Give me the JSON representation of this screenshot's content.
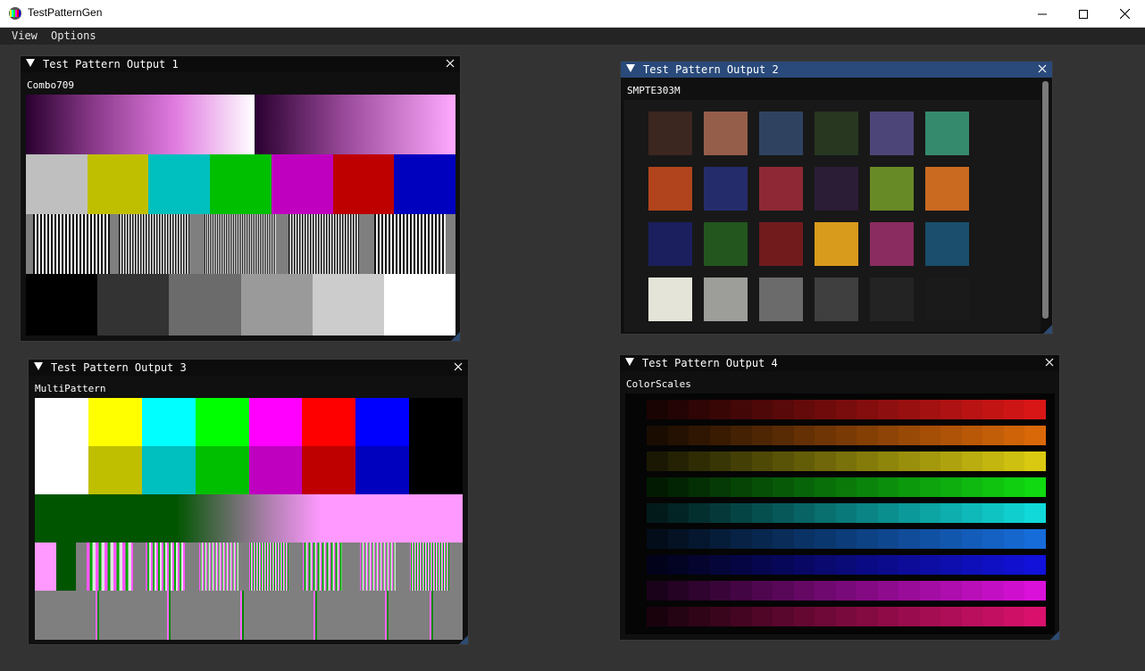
{
  "app": {
    "title": "TestPatternGen",
    "icon": "color-bars-app-icon",
    "window_controls": [
      "minimize-icon",
      "maximize-icon",
      "close-icon"
    ]
  },
  "menu": {
    "items": [
      {
        "label": "View"
      },
      {
        "label": "Options"
      }
    ]
  },
  "windows": [
    {
      "title": "Test Pattern Output 1",
      "pattern": "Combo709",
      "active": false
    },
    {
      "title": "Test Pattern Output 2",
      "pattern": "SMPTE303M",
      "active": true
    },
    {
      "title": "Test Pattern Output 3",
      "pattern": "MultiPattern",
      "active": false
    },
    {
      "title": "Test Pattern Output 4",
      "pattern": "ColorScales",
      "active": false
    }
  ],
  "colors": {
    "titlebar_active": "#294a7a",
    "window_bg": "#101010",
    "desktop_bg": "#333333",
    "bars75": [
      "#bfbfbf",
      "#bfbf00",
      "#00bfbf",
      "#00bf00",
      "#bf00bf",
      "#bf0000",
      "#0000bf"
    ],
    "bars100_top": [
      "#ffffff",
      "#ffff00",
      "#00ffff",
      "#00ff00",
      "#ff00ff",
      "#ff0000",
      "#0000ff",
      "#000000"
    ],
    "bars75_bottom": [
      "#ffffff",
      "#bfbf00",
      "#00bfbf",
      "#00bf00",
      "#bf00bf",
      "#bf0000",
      "#0000bf",
      "#000000"
    ],
    "gray_steps": [
      "#000000",
      "#333333",
      "#6b6b6b",
      "#9a9a9a",
      "#cccccc",
      "#ffffff"
    ],
    "smpte303m_chips": [
      [
        "#3c2620",
        "#955e4a",
        "#2f4361",
        "#273720",
        "#4c4678",
        "#358a6e"
      ],
      [
        "#b1441c",
        "#242c6c",
        "#8e2834",
        "#2c1d37",
        "#688a26",
        "#c96a20"
      ],
      [
        "#1b1f5d",
        "#23561f",
        "#711b1d",
        "#d99b1c",
        "#8a2c5f",
        "#1a4e6c"
      ],
      [
        "#e4e4d9",
        "#9d9d99",
        "#6b6b6b",
        "#3f3f3f",
        "#232323",
        "#1a1a1a"
      ]
    ],
    "color_scales": [
      "#ff1a1a",
      "#ff7a0a",
      "#ffee14",
      "#14ff14",
      "#14ffff",
      "#1a7fff",
      "#1414ff",
      "#ff14ff",
      "#ff1480"
    ]
  }
}
